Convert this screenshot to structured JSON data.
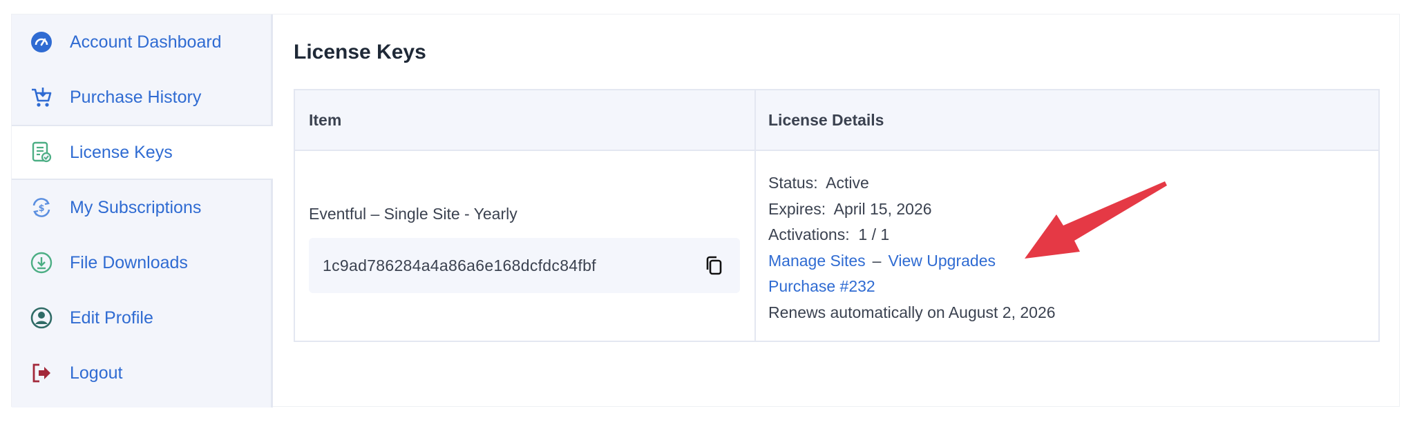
{
  "sidebar": {
    "items": [
      {
        "label": "Account Dashboard",
        "icon": "gauge-icon",
        "color": "#2f6bd2"
      },
      {
        "label": "Purchase History",
        "icon": "cart-icon",
        "color": "#2f6bd2"
      },
      {
        "label": "License Keys",
        "icon": "license-icon",
        "color": "#4cae84",
        "active": true
      },
      {
        "label": "My Subscriptions",
        "icon": "subscription-icon",
        "color": "#5b8fe0"
      },
      {
        "label": "File Downloads",
        "icon": "download-icon",
        "color": "#4cae84"
      },
      {
        "label": "Edit Profile",
        "icon": "profile-icon",
        "color": "#2f6b66"
      },
      {
        "label": "Logout",
        "icon": "logout-icon",
        "color": "#a3283a"
      }
    ]
  },
  "main": {
    "title": "License Keys",
    "table": {
      "headers": [
        "Item",
        "License Details"
      ],
      "row": {
        "item_name": "Eventful – Single Site - Yearly",
        "license_key": "1c9ad786284a4a86a6e168dcfdc84fbf",
        "status_label": "Status:",
        "status_value": "Active",
        "expires_label": "Expires:",
        "expires_value": "April 15, 2026",
        "activations_label": "Activations:",
        "activations_value": "1 / 1",
        "manage_sites": "Manage Sites",
        "separator": "–",
        "view_upgrades": "View Upgrades",
        "purchase_link": "Purchase #232",
        "renewal_text": "Renews automatically on August 2, 2026"
      }
    }
  },
  "colors": {
    "link": "#2f6bd2",
    "annotation_arrow": "#e53945"
  }
}
